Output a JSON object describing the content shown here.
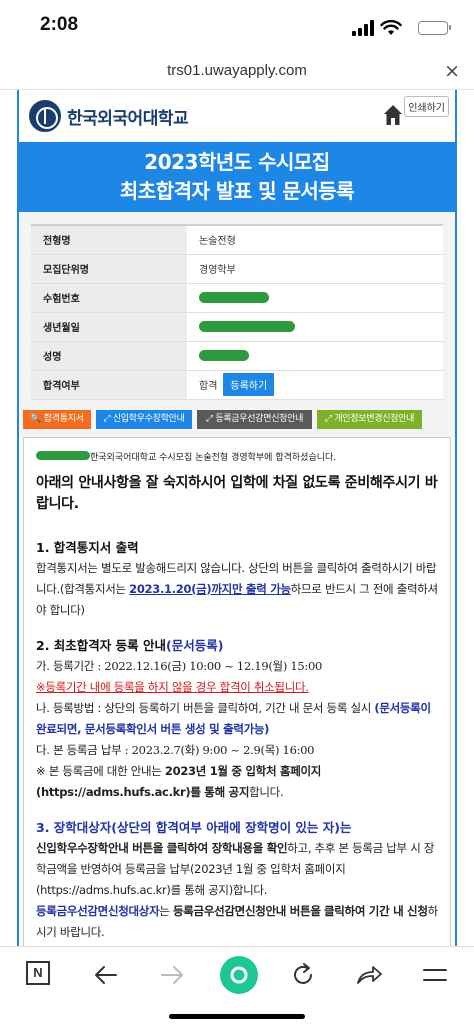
{
  "status": {
    "time": "2:08"
  },
  "browser": {
    "url": "trs01.uwayapply.com",
    "close_glyph": "×"
  },
  "site": {
    "name": "한국외국어대학교",
    "print_label": "인쇄하기"
  },
  "banner": {
    "line1": "2023학년도 수시모집",
    "line2": "최초합격자 발표 및 문서등록"
  },
  "info": {
    "rows": [
      {
        "label": "전형명",
        "value": "논술전형"
      },
      {
        "label": "모집단위명",
        "value": "경영학부"
      },
      {
        "label": "수험번호",
        "value": ""
      },
      {
        "label": "생년월일",
        "value": ""
      },
      {
        "label": "성명",
        "value": ""
      },
      {
        "label": "합격여부",
        "value": "합격"
      }
    ],
    "register_button": "등록하기"
  },
  "buttons": {
    "b1": "합격통지서",
    "b2": "신입학우수장학안내",
    "b3": "등록금우선감면신청안내",
    "b4": "개인정보변경신청안내"
  },
  "content": {
    "greet": "한국외국어대학교 수시모집 논술전형 경영학부에 합격하셨습니다.",
    "lead": "아래의 안내사항을 잘 숙지하시어 입학에 차질 없도록 준비해주시기 바랍니다.",
    "s1_title": "1. 합격통지서 출력",
    "s1_a": "합격통지서는 별도로 발송해드리지 않습니다. 상단의 버튼을 클릭하여 출력하시기 바랍니다.(합격통지서는 ",
    "s1_b": "2023.1.20(금)까지만 출력 가능",
    "s1_c": "하므로 반드시 그 전에 출력하셔야 합니다)",
    "s2_title_a": "2. 최초합격자 등록 안내",
    "s2_title_b": "(문서등록)",
    "s2_ga": "가. 등록기간 : 2022.12.16(금) 10:00 ~ 12.19(월) 15:00",
    "s2_warn": "※등록기간 내에 등록을 하지 않을 경우 합격이 취소됩니다.",
    "s2_na_a": "나. 등록방법 : 상단의 등록하기 버튼을 클릭하여, 기간 내 문서 등록 실시 ",
    "s2_na_b": "(문서등록이 완료되면, 문서등록확인서 버튼 생성 및 출력가능)",
    "s2_da": "다. 본 등록금 납부 : 2023.2.7(화) 9:00 ~ 2.9(목) 16:00",
    "s2_note_a": "※ 본 등록금에 대한 안내는 ",
    "s2_note_b": "2023년 1월 중 입학처 홈페이지 (https://adms.hufs.ac.kr)를 통해 공지",
    "s2_note_c": "합니다.",
    "s3_title": "3. 장학대상자(상단의 합격여부 아래에 장학명이 있는 자)는",
    "s3_a": "신입학우수장학안내 버튼을 클릭하여 장학내용을 확인",
    "s3_b": "하고, 추후 본 등록금 납부 시 장학금액을 반영하여 등록금을 납부(2023년 1월 중 입학처 홈페이지 (https://adms.hufs.ac.kr)를 통해 공지)합니다.",
    "s3_c": "등록금우선감면신청대상자",
    "s3_d": "는 ",
    "s3_e": "등록금우선감면신청안내 버튼을",
    "s3_f": "클릭하여 기간 내 신청",
    "s3_g": "하시기 바랍니다."
  },
  "toolbar": {
    "n_label": "N"
  }
}
